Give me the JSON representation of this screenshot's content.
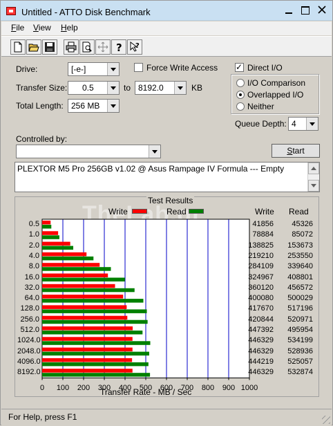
{
  "window": {
    "title": "Untitled - ATTO Disk Benchmark"
  },
  "menu": [
    "File",
    "View",
    "Help"
  ],
  "toolbar": [
    "new-icon",
    "open-icon",
    "save-icon",
    "print-icon",
    "print-preview-icon",
    "move-icon",
    "help-icon",
    "context-help-icon"
  ],
  "form": {
    "drive_label": "Drive:",
    "drive_value": "[-e-]",
    "force_write_label": "Force Write Access",
    "force_write_checked": false,
    "direct_io_label": "Direct I/O",
    "direct_io_checked": true,
    "transfer_size_label": "Transfer Size:",
    "transfer_from": "0.5",
    "to_label": "to",
    "transfer_to": "8192.0",
    "kb_label": "KB",
    "total_length_label": "Total Length:",
    "total_length_value": "256 MB",
    "io_comparison_label": "I/O Comparison",
    "overlapped_io_label": "Overlapped I/O",
    "neither_label": "Neither",
    "selected_mode": "Overlapped I/O",
    "queue_depth_label": "Queue Depth:",
    "queue_depth_value": "4",
    "controlled_by_label": "Controlled by:",
    "controlled_by_value": "",
    "start_label": "Start",
    "description": "PLEXTOR M5 Pro 256GB v1.02 @ Asus Rampage IV Formula --- Empty"
  },
  "results": {
    "title": "Test Results",
    "write_label": "Write",
    "read_label": "Read",
    "write_col": "Write",
    "read_col": "Read",
    "watermark": "TheLab.gr",
    "xlabel": "Transfer Rate - MB / Sec"
  },
  "chart_data": {
    "type": "bar",
    "orientation": "horizontal",
    "title": "Test Results",
    "xlabel": "Transfer Rate - MB / Sec",
    "xlim": [
      0,
      1000
    ],
    "xticks": [
      "0",
      "100",
      "200",
      "300",
      "400",
      "500",
      "600",
      "700",
      "800",
      "900",
      "1000"
    ],
    "categories": [
      "0.5",
      "1.0",
      "2.0",
      "4.0",
      "8.0",
      "16.0",
      "32.0",
      "64.0",
      "128.0",
      "256.0",
      "512.0",
      "1024.0",
      "2048.0",
      "4096.0",
      "8192.0"
    ],
    "series": [
      {
        "name": "Write",
        "color": "#ff0000",
        "values": [
          41856,
          78884,
          138825,
          219210,
          284109,
          324967,
          360120,
          400080,
          417670,
          420844,
          447392,
          446329,
          446329,
          444219,
          446329
        ]
      },
      {
        "name": "Read",
        "color": "#008000",
        "values": [
          45326,
          85072,
          153673,
          253550,
          339640,
          408801,
          456572,
          500029,
          517196,
          520971,
          495954,
          534199,
          528936,
          525057,
          532874
        ]
      }
    ],
    "units_note": "values in KB/s"
  },
  "status": {
    "text": "For Help, press F1"
  }
}
